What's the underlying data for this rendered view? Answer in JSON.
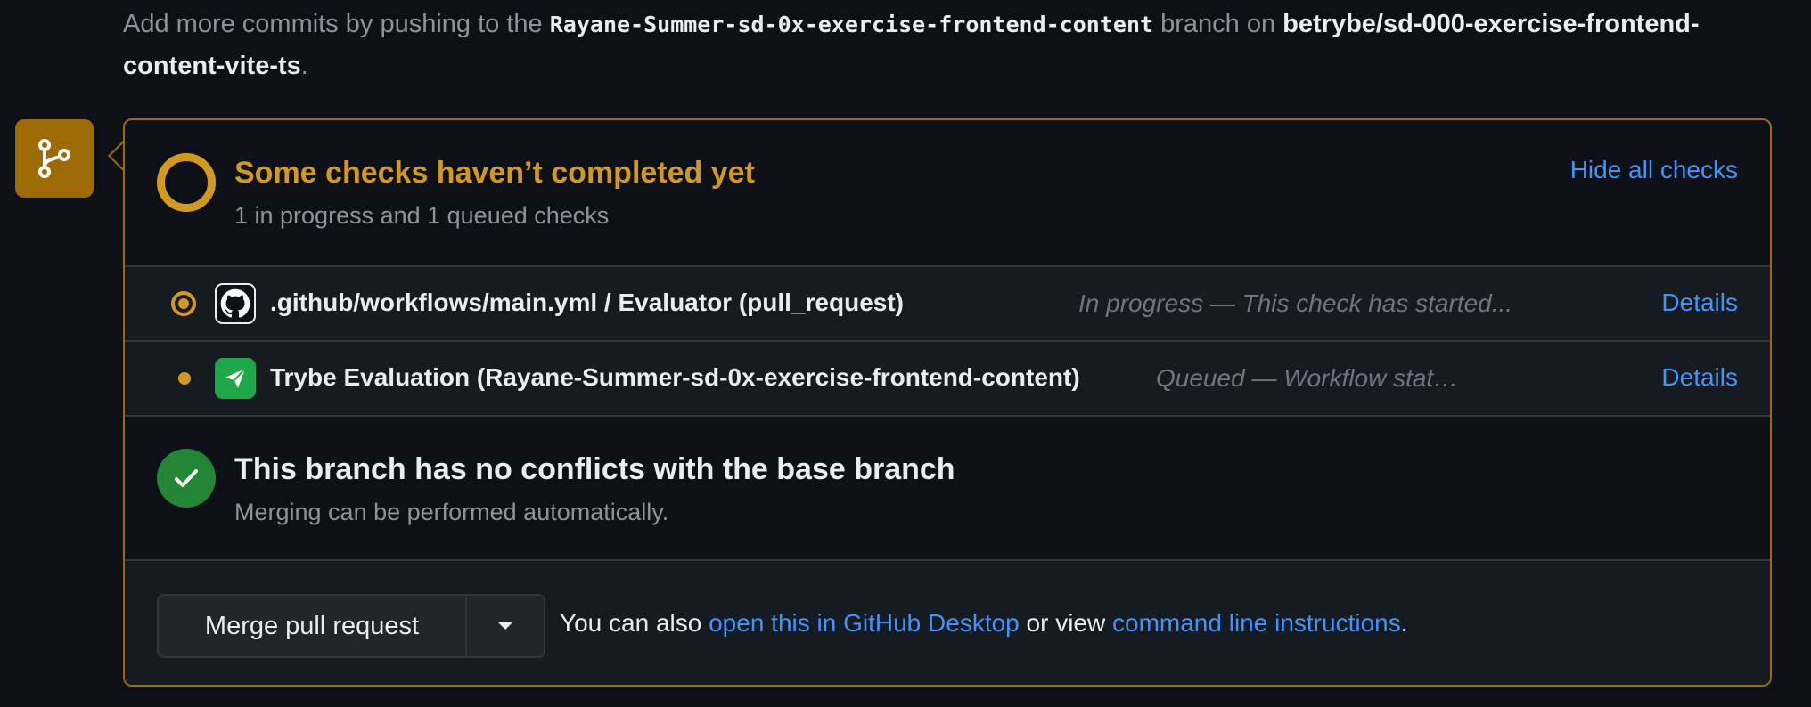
{
  "intro": {
    "prefix": "Add more commits by pushing to the",
    "branch": "Rayane-Summer-sd-0x-exercise-frontend-content",
    "middle": "branch on",
    "repo": "betrybe/sd-000-exercise-frontend-content-vite-ts",
    "suffix": "."
  },
  "checks": {
    "title": "Some checks haven’t completed yet",
    "subtitle": "1 in progress and 1 queued checks",
    "hide_label": "Hide all checks",
    "items": [
      {
        "icon": "github-icon",
        "name": ".github/workflows/main.yml / Evaluator (pull_request)",
        "description": "In progress — This check has started...",
        "details_label": "Details"
      },
      {
        "icon": "trybe-icon",
        "name": "Trybe Evaluation (Rayane-Summer-sd-0x-exercise-frontend-content)",
        "description": "Queued — Workflow stat…",
        "details_label": "Details"
      }
    ]
  },
  "conflicts": {
    "title": "This branch has no conflicts with the base branch",
    "subtitle": "Merging can be performed automatically."
  },
  "merge": {
    "button_label": "Merge pull request",
    "text_prefix": "You can also",
    "desktop_link": "open this in GitHub Desktop",
    "text_middle": "or view",
    "cli_link": "command line instructions",
    "text_suffix": "."
  },
  "colors": {
    "background": "#0d1117",
    "warning": "#d29922",
    "success": "#238636",
    "link": "#4493f8"
  }
}
